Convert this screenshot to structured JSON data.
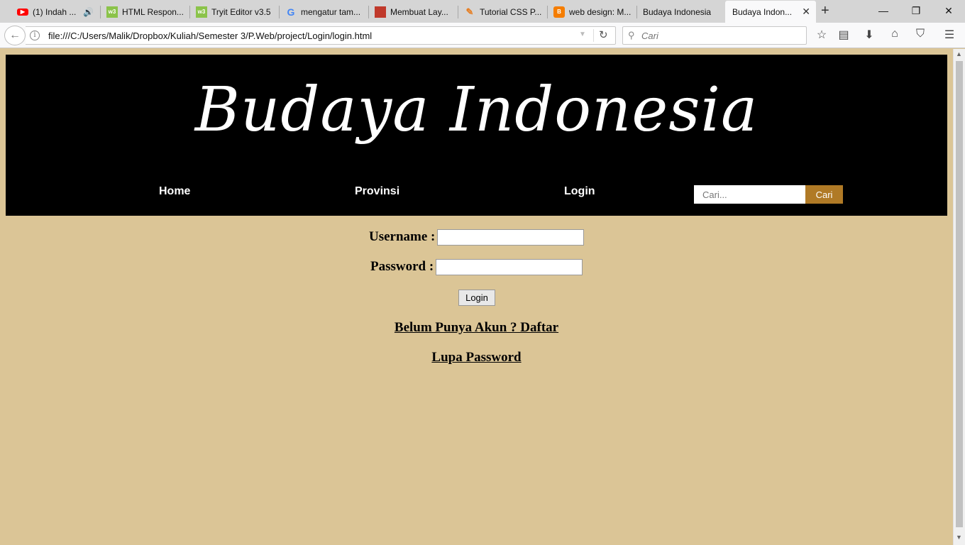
{
  "browser": {
    "tabs": [
      {
        "label": "(1) Indah ...",
        "favicon": "youtube-icon",
        "color": "#ff0000"
      },
      {
        "label": "HTML Respon...",
        "favicon": "w3schools-icon",
        "color": "#8bc34a"
      },
      {
        "label": "Tryit Editor v3.5",
        "favicon": "w3schools-icon",
        "color": "#8bc34a"
      },
      {
        "label": "mengatur tam...",
        "favicon": "google-icon",
        "color": "#4285f4"
      },
      {
        "label": "Membuat Lay...",
        "favicon": "page-icon",
        "color": "#c0392b"
      },
      {
        "label": "Tutorial CSS P...",
        "favicon": "pencil-icon",
        "color": "#e67e22"
      },
      {
        "label": "web design: M...",
        "favicon": "blogger-icon",
        "color": "#f57d00"
      },
      {
        "label": "Budaya Indonesia",
        "favicon": "none"
      },
      {
        "label": "Budaya Indon...",
        "favicon": "none",
        "active": true
      }
    ],
    "url": "file:///C:/Users/Malik/Dropbox/Kuliah/Semester 3/P.Web/project/Login/login.html",
    "search_placeholder": "Cari"
  },
  "header": {
    "logo_text": "Budaya Indonesia",
    "menu": [
      "Home",
      "Provinsi",
      "Login"
    ],
    "search_placeholder": "Cari...",
    "search_button": "Cari",
    "accent_color": "#b07a26"
  },
  "form": {
    "username_label": "Username :",
    "password_label": "Password :",
    "login_button": "Login",
    "register_link": "Belum Punya Akun ? Daftar",
    "forgot_link": "Lupa Password"
  },
  "colors": {
    "page_background": "#dbc596",
    "header_background": "#000000"
  }
}
